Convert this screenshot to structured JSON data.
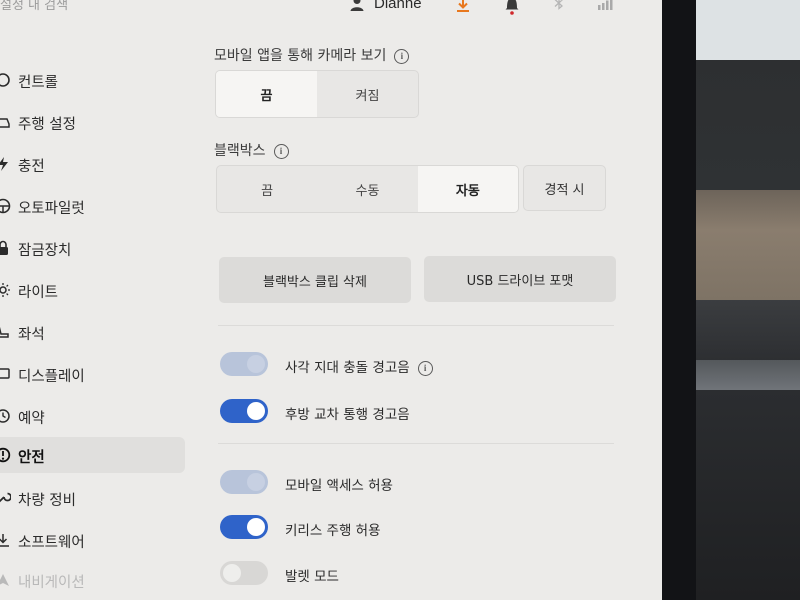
{
  "topbar": {
    "search_placeholder": "설정 내 검색",
    "user_name": "Dianne"
  },
  "sidebar": {
    "items": [
      {
        "label": "컨트롤",
        "icon": "toggle-icon"
      },
      {
        "label": "주행 설정",
        "icon": "car-icon"
      },
      {
        "label": "충전",
        "icon": "charging-icon"
      },
      {
        "label": "오토파일럿",
        "icon": "steering-wheel-icon"
      },
      {
        "label": "잠금장치",
        "icon": "lock-icon"
      },
      {
        "label": "라이트",
        "icon": "light-icon"
      },
      {
        "label": "좌석",
        "icon": "seat-icon"
      },
      {
        "label": "디스플레이",
        "icon": "display-icon"
      },
      {
        "label": "예약",
        "icon": "clock-icon"
      },
      {
        "label": "안전",
        "icon": "alert-icon",
        "active": true
      },
      {
        "label": "차량 정비",
        "icon": "wrench-icon"
      },
      {
        "label": "소프트웨어",
        "icon": "download-icon"
      },
      {
        "label": "내비게이션",
        "icon": "navigation-icon"
      }
    ]
  },
  "camera": {
    "title": "모바일 앱을 통해 카메라 보기",
    "options": [
      "끔",
      "켜짐"
    ],
    "selected": "끔"
  },
  "dashcam": {
    "title": "블랙박스",
    "options": [
      "끔",
      "수동",
      "자동"
    ],
    "selected": "자동",
    "extra_option": "경적 시"
  },
  "actions": {
    "delete_clips": "블랙박스 클립 삭제",
    "format_usb": "USB 드라이브 포맷"
  },
  "toggles_group1": [
    {
      "label": "사각 지대 충돌 경고음",
      "state": "on-disabled",
      "info": true
    },
    {
      "label": "후방 교차 통행 경고음",
      "state": "on"
    }
  ],
  "toggles_group2": [
    {
      "label": "모바일 액세스 허용",
      "state": "on-disabled"
    },
    {
      "label": "키리스 주행 허용",
      "state": "on"
    },
    {
      "label": "발렛 모드",
      "state": "off"
    }
  ]
}
